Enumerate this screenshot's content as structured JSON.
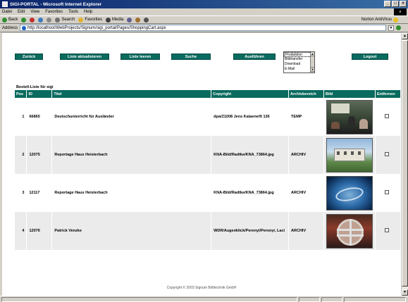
{
  "window": {
    "title": "SIGI-PORTAL - Microsoft Internet Explorer",
    "throbber": "e"
  },
  "menu": [
    "Datei",
    "Edit",
    "View",
    "Favorites",
    "Tools",
    "Help"
  ],
  "toolbar": {
    "back": "Back",
    "search": "Search",
    "favorites": "Favorites",
    "media": "Media",
    "norton": "Norton AntiVirus"
  },
  "address": {
    "label": "Address",
    "url": "http://localhost/WebProjects/Signum/sigi_portal/Pages/ShoppingCart.aspx"
  },
  "actions": {
    "back": "Zurück",
    "refresh": "Liste aktualisieren",
    "clear": "Liste leeren",
    "search": "Suche",
    "execute": "Ausführen",
    "logout": "Logout"
  },
  "action_options": {
    "items": [
      "Produktion",
      "Bildtransfer",
      "Download",
      "E-Mail"
    ],
    "selected": "Produktion"
  },
  "list": {
    "title": "Bestell-Liste für sigi",
    "columns": [
      "Pos",
      "ID",
      "Titel",
      "Copyright",
      "Archivbereich",
      "Bild",
      "Entfernen"
    ],
    "rows": [
      {
        "pos": "1",
        "id": "66865",
        "title": "Deutschunterricht für Ausländer",
        "copyright": "dpa/Z1008 Jens Kalaene/ft 136",
        "archive": "TEMP"
      },
      {
        "pos": "2",
        "id": "12075",
        "title": "Reportage Haus Heisterbach",
        "copyright": "KNA-Bild/Radtke/KNA_73864.jpg",
        "archive": "ARCHIV"
      },
      {
        "pos": "3",
        "id": "12117",
        "title": "Reportage Haus Heisterbach",
        "copyright": "KNA-Bild/Radtke/KNA_73864.jpg",
        "archive": "ARCHIV"
      },
      {
        "pos": "4",
        "id": "12076",
        "title": "Patrick Venzke",
        "copyright": "WDR/Augenklick/Perenyi/Perenyi, Laci",
        "archive": "ARCHIV"
      }
    ]
  },
  "footer": "Copyright © 2003 Signum Bildtechnik GmbH",
  "colors": {
    "accent": "#0a6b5f",
    "titlebar": "#0a246a"
  }
}
